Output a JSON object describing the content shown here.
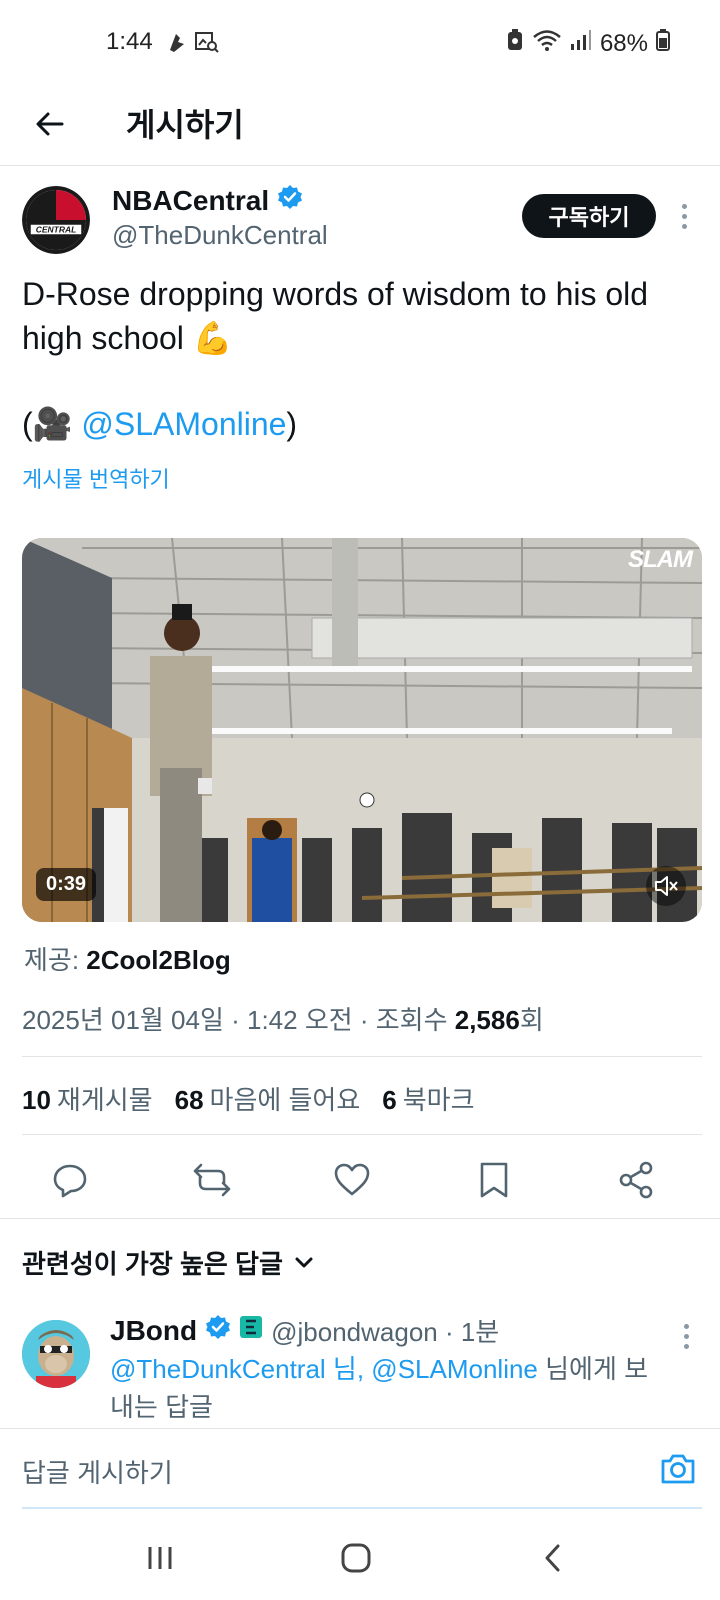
{
  "status": {
    "time": "1:44",
    "battery": "68%"
  },
  "header": {
    "title": "게시하기"
  },
  "author": {
    "name": "NBACentral",
    "handle": "@TheDunkCentral",
    "subscribe_label": "구독하기",
    "avatar_text": "CENTRAL"
  },
  "tweet": {
    "text": "D-Rose dropping words of wisdom to his old high school 💪",
    "credit_prefix": "(🎥 ",
    "credit_link": "@SLAMonline",
    "credit_suffix": ")",
    "translate_label": "게시물 번역하기"
  },
  "media": {
    "duration": "0:39",
    "watermark": "SLAM"
  },
  "provider": {
    "label": "제공: ",
    "name": "2Cool2Blog"
  },
  "meta": {
    "date": "2025년 01월 04일 · 1:42 오전 · 조회수 ",
    "views": "2,586",
    "views_suffix": "회"
  },
  "stats": {
    "reposts_count": "10",
    "reposts_label": "재게시물",
    "likes_count": "68",
    "likes_label": "마음에 들어요",
    "bookmarks_count": "6",
    "bookmarks_label": "북마크"
  },
  "replies": {
    "sort_label": "관련성이 가장 높은 답글",
    "items": [
      {
        "name": "JBond",
        "handle": "@jbondwagon · 1분",
        "reply_to_link": "@TheDunkCentral 님, @SLAMonline",
        "reply_to_suffix": " 님에게 보내는 답글"
      }
    ]
  },
  "compose": {
    "placeholder": "답글 게시하기"
  },
  "colors": {
    "accent": "#1d9bf0",
    "text": "#0f1419",
    "muted": "#536471"
  }
}
